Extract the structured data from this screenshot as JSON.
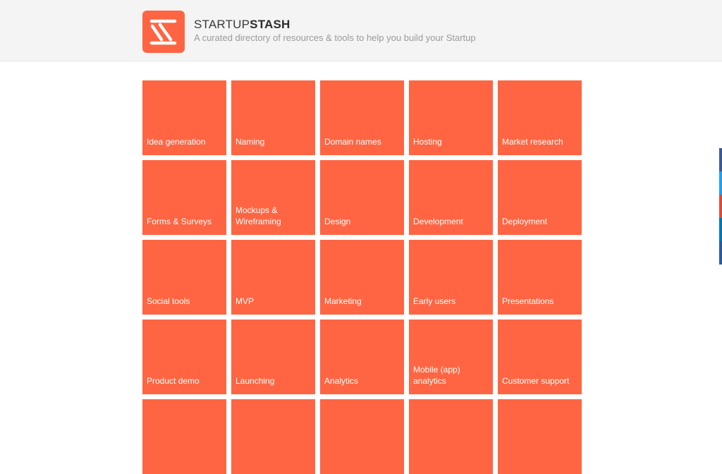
{
  "header": {
    "brand_part1": "STARTUP",
    "brand_part2": "STASH",
    "tagline": "A curated directory of resources & tools to help you build your Startup",
    "logo_icon": "startupstash-logo-icon",
    "logo_color": "#ff6542"
  },
  "categories": [
    "Idea generation",
    "Naming",
    "Domain names",
    "Hosting",
    "Market research",
    "Forms & Surveys",
    "Mockups &\nWireframing",
    "Design",
    "Development",
    "Deployment",
    "Social tools",
    "MVP",
    "Marketing",
    "Early users",
    "Presentations",
    "Product demo",
    "Launching",
    "Analytics",
    "Mobile (app) analytics",
    "Customer support",
    "",
    "",
    "",
    "",
    ""
  ],
  "tile_color": "#ff6542",
  "share_bar": [
    {
      "icon": "facebook-icon",
      "color": "#3b5998"
    },
    {
      "icon": "twitter-icon",
      "color": "#1da1f2"
    },
    {
      "icon": "google-plus-icon",
      "color": "#dd4b39"
    },
    {
      "icon": "linkedin-icon",
      "color": "#0077b5"
    },
    {
      "icon": "share-icon",
      "color": "#2a5aa0"
    }
  ]
}
